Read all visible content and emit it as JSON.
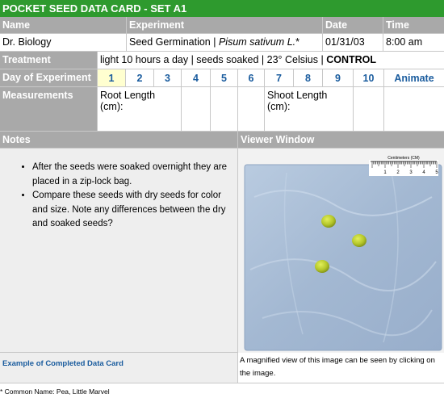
{
  "title": "POCKET SEED DATA CARD  - SET A1",
  "header": {
    "name": "Name",
    "experiment": "Experiment",
    "date": "Date",
    "time": "Time"
  },
  "info": {
    "name": "Dr. Biology",
    "experiment_prefix": "Seed  Germination | ",
    "species": "Pisum sativum L.",
    "asterisk": "*",
    "date": "01/31/03",
    "time": "8:00 am"
  },
  "treatment": {
    "label": "Treatment",
    "text": "light 10 hours a day | seeds soaked | 23° Celsius | ",
    "control": "CONTROL"
  },
  "days": {
    "label": "Day of Experiment",
    "values": [
      "1",
      "2",
      "3",
      "4",
      "5",
      "6",
      "7",
      "8",
      "9",
      "10"
    ],
    "animate": "Animate"
  },
  "measurements": {
    "label": "Measurements",
    "root": "Root Length (cm):",
    "shoot": "Shoot Length (cm):"
  },
  "notes": {
    "label": "Notes",
    "items": [
      "After the seeds were soaked overnight they are placed in a zip-lock bag.",
      "Compare these seeds with dry seeds for color and size. Note any differences between the dry and soaked seeds?"
    ]
  },
  "viewer": {
    "label": "Viewer Window",
    "ruler_label": "Centimeters (CM)",
    "ruler_numbers": [
      "1",
      "2",
      "3",
      "4",
      "5"
    ],
    "caption": "A magnified view of this image can be seen by clicking on the image."
  },
  "links": {
    "example": "Example of Completed Data Card"
  },
  "footnote": "* Common Name: Pea, Little Marvel"
}
